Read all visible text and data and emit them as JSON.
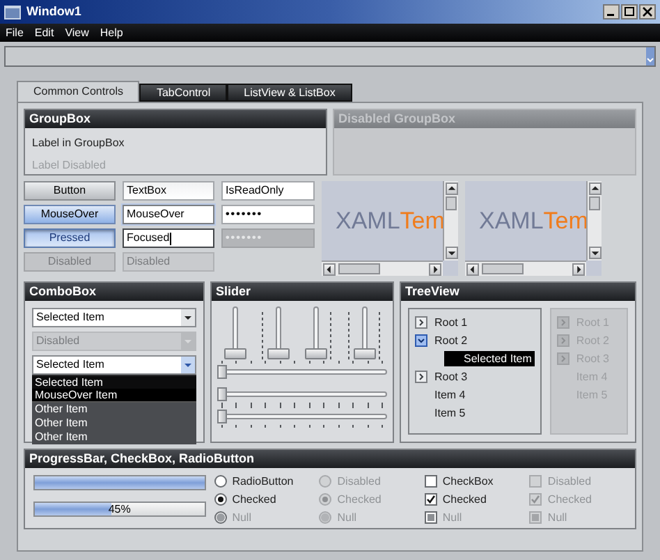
{
  "window": {
    "title": "Window1"
  },
  "menu": [
    "File",
    "Edit",
    "View",
    "Help"
  ],
  "tabs": [
    {
      "label": "Common Controls",
      "selected": true
    },
    {
      "label": "TabControl",
      "selected": false
    },
    {
      "label": "ListView & ListBox",
      "selected": false
    }
  ],
  "groupboxes": [
    {
      "title": "GroupBox",
      "disabled": false,
      "labels": [
        {
          "text": "Label in GroupBox",
          "disabled": false
        },
        {
          "text": "Label Disabled",
          "disabled": true
        }
      ]
    },
    {
      "title": "Disabled GroupBox",
      "disabled": true
    }
  ],
  "buttons": [
    {
      "label": "Button",
      "hover": false,
      "pressed": false,
      "disabled": false
    },
    {
      "label": "MouseOver",
      "hover": true,
      "pressed": false,
      "disabled": false
    },
    {
      "label": "Pressed",
      "hover": false,
      "pressed": true,
      "disabled": false
    },
    {
      "label": "Disabled",
      "hover": false,
      "pressed": false,
      "disabled": true
    }
  ],
  "textboxes": [
    {
      "value": "TextBox",
      "hover": false,
      "focused": false,
      "disabled": false
    },
    {
      "value": "MouseOver",
      "hover": true,
      "focused": false,
      "disabled": false
    },
    {
      "value": "Focused",
      "hover": false,
      "focused": true,
      "disabled": false
    },
    {
      "value": "Disabled",
      "hover": false,
      "focused": false,
      "disabled": true
    }
  ],
  "password_column": [
    {
      "kind": "text",
      "value": "IsReadOnly",
      "disabled": false
    },
    {
      "kind": "password",
      "value": "•••••••",
      "disabled": false
    },
    {
      "kind": "password",
      "value": "•••••••",
      "disabled": true
    }
  ],
  "scroll_viewers": [
    {
      "text_1": "XAML",
      "text_2": "Tem"
    },
    {
      "text_1": "XAML",
      "text_2": "Tem"
    }
  ],
  "combobox": {
    "title": "ComboBox",
    "boxes": [
      {
        "value": "Selected Item",
        "disabled": false,
        "open": false
      },
      {
        "value": "Disabled",
        "disabled": true,
        "open": false
      },
      {
        "value": "Selected Item",
        "disabled": false,
        "open": true
      }
    ],
    "dropdown": [
      {
        "label": "Selected Item",
        "selected": true,
        "hover": false
      },
      {
        "label": "MouseOver Item",
        "selected": false,
        "hover": true
      },
      {
        "label": "Other Item",
        "selected": false,
        "hover": false
      },
      {
        "label": "Other Item",
        "selected": false,
        "hover": false
      },
      {
        "label": "Other Item",
        "selected": false,
        "hover": false
      }
    ]
  },
  "slider": {
    "title": "Slider",
    "vertical": [
      {
        "level": 0,
        "ticks_before": false,
        "ticks_after": false
      },
      {
        "level": 0,
        "ticks_before": true,
        "ticks_after": false
      },
      {
        "level": 0,
        "ticks_before": false,
        "ticks_after": true
      },
      {
        "level": 0,
        "ticks_before": true,
        "ticks_after": true
      }
    ],
    "horizontal": [
      {
        "level": 0,
        "ticks_before": true,
        "ticks_after": false
      },
      {
        "level": 0,
        "ticks_before": false,
        "ticks_after": true
      },
      {
        "level": 0,
        "ticks_before": true,
        "ticks_after": true
      }
    ]
  },
  "treeview": {
    "title": "TreeView",
    "trees": [
      {
        "disabled": false,
        "items": [
          {
            "label": "Root 1",
            "expandable": true,
            "expanded": false,
            "selected": false
          },
          {
            "label": "Root 2",
            "expandable": true,
            "expanded": true,
            "selected": false,
            "children": [
              {
                "label": "Selected Item",
                "selected": true
              }
            ]
          },
          {
            "label": "Root 3",
            "expandable": true,
            "expanded": false,
            "selected": false
          },
          {
            "label": "Item 4",
            "expandable": false,
            "selected": false
          },
          {
            "label": "Item 5",
            "expandable": false,
            "selected": false
          }
        ]
      },
      {
        "disabled": true,
        "items": [
          {
            "label": "Root 1",
            "expandable": true,
            "expanded": false,
            "selected": false
          },
          {
            "label": "Root 2",
            "expandable": true,
            "expanded": false,
            "selected": false
          },
          {
            "label": "Root 3",
            "expandable": true,
            "expanded": false,
            "selected": false
          },
          {
            "label": "Item 4",
            "expandable": false,
            "selected": false
          },
          {
            "label": "Item 5",
            "expandable": false,
            "selected": false
          }
        ]
      }
    ]
  },
  "progress_group": {
    "title": "ProgressBar, CheckBox, RadioButton",
    "bars": [
      {
        "level": 1
      },
      {
        "level": 0.45,
        "label": "45%"
      }
    ],
    "columns": [
      {
        "kind": "radio",
        "disabled": false,
        "items": [
          {
            "label": "RadioButton",
            "checked": false,
            "indeterminate": false
          },
          {
            "label": "Checked",
            "checked": true,
            "indeterminate": false
          },
          {
            "label": "Null",
            "checked": false,
            "indeterminate": true
          }
        ]
      },
      {
        "kind": "radio",
        "disabled": true,
        "items": [
          {
            "label": "Disabled",
            "checked": false,
            "indeterminate": false
          },
          {
            "label": "Checked",
            "checked": true,
            "indeterminate": false
          },
          {
            "label": "Null",
            "checked": false,
            "indeterminate": true
          }
        ]
      },
      {
        "kind": "checkbox",
        "disabled": false,
        "items": [
          {
            "label": "CheckBox",
            "checked": false,
            "indeterminate": false
          },
          {
            "label": "Checked",
            "checked": true,
            "indeterminate": false
          },
          {
            "label": "Null",
            "checked": false,
            "indeterminate": true
          }
        ]
      },
      {
        "kind": "checkbox",
        "disabled": true,
        "items": [
          {
            "label": "Disabled",
            "checked": false,
            "indeterminate": false
          },
          {
            "label": "Checked",
            "checked": true,
            "indeterminate": false
          },
          {
            "label": "Null",
            "checked": false,
            "indeterminate": true
          }
        ]
      }
    ]
  }
}
